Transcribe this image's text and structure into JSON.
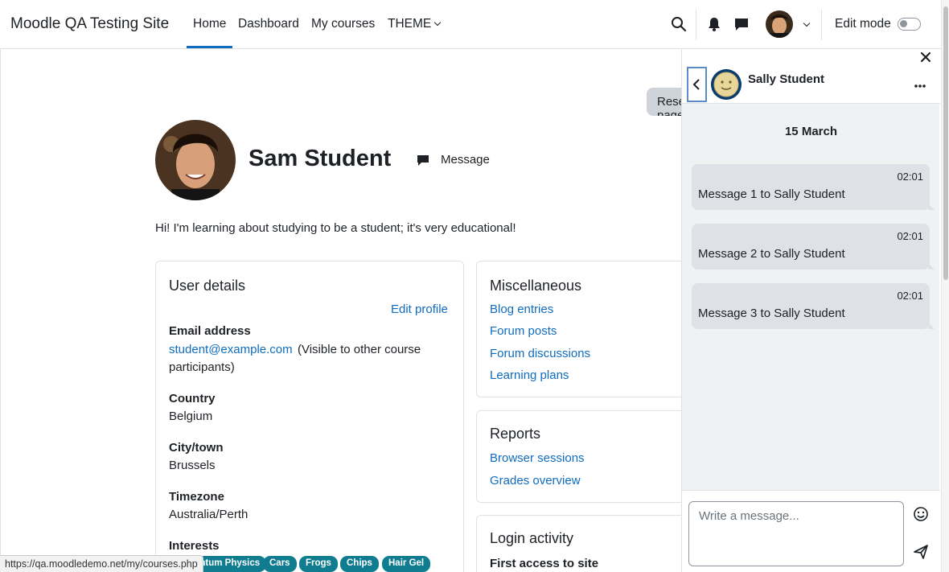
{
  "navbar": {
    "brand": "Moodle QA Testing Site",
    "links": [
      "Home",
      "Dashboard",
      "My courses",
      "THEME"
    ],
    "edit_mode": "Edit mode"
  },
  "main": {
    "reset_label": "Reset page to default",
    "profile_name": "Sam Student",
    "message_label": "Message",
    "bio": "Hi! I'm learning about studying to be a student; it's very educational!",
    "user_details": {
      "title": "User details",
      "edit_profile": "Edit profile",
      "email_label": "Email address",
      "email_value": "student@example.com",
      "email_note": "(Visible to other course",
      "email_note2": "participants)",
      "country_label": "Country",
      "country_value": "Belgium",
      "city_label": "City/town",
      "city_value": "Brussels",
      "timezone_label": "Timezone",
      "timezone_value": "Australia/Perth",
      "interests_label": "Interests",
      "interests": [
        "Quantum Physics",
        "Cars",
        "Frogs",
        "Chips",
        "Hair Gel"
      ]
    },
    "misc": {
      "title": "Miscellaneous",
      "links": [
        "Blog entries",
        "Forum posts",
        "Forum discussions",
        "Learning plans"
      ]
    },
    "reports": {
      "title": "Reports",
      "links": [
        "Browser sessions",
        "Grades overview"
      ]
    },
    "login": {
      "title": "Login activity",
      "first_access": "First access to site"
    }
  },
  "status_url": "https://qa.moodledemo.net/my/courses.php",
  "drawer": {
    "contact_name": "Sally Student",
    "date": "15 March",
    "messages": [
      {
        "time": "02:01",
        "text": "Message 1 to Sally Student"
      },
      {
        "time": "02:01",
        "text": "Message 2 to Sally Student"
      },
      {
        "time": "02:01",
        "text": "Message 3 to Sally Student"
      }
    ],
    "input_placeholder": "Write a message..."
  },
  "colors": {
    "link": "#0f6cbf",
    "tag": "#0f7c8f",
    "focus": "#5a8dc6"
  }
}
